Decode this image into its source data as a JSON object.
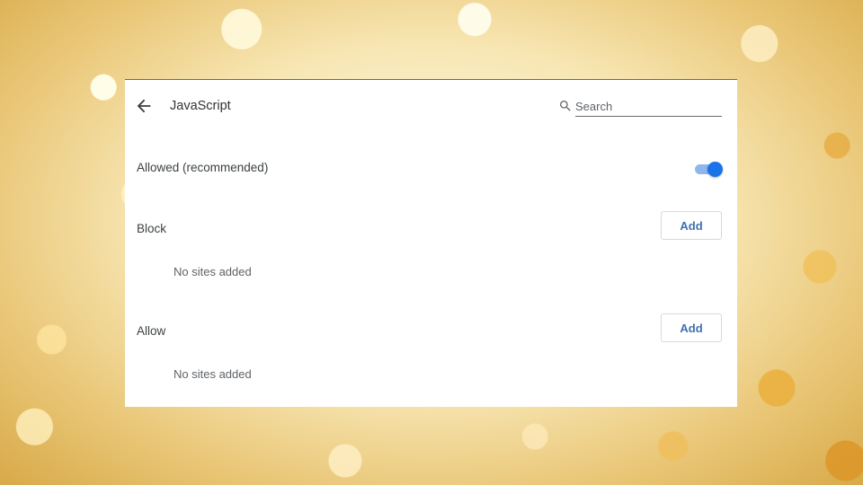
{
  "header": {
    "title": "JavaScript",
    "search_placeholder": "Search"
  },
  "default_setting": {
    "label": "Allowed (recommended)",
    "enabled": true
  },
  "sections": [
    {
      "label": "Block",
      "add_label": "Add",
      "empty_text": "No sites added"
    },
    {
      "label": "Allow",
      "add_label": "Add",
      "empty_text": "No sites added"
    }
  ],
  "colors": {
    "accent": "#1a73e8",
    "toggle_track": "#8fb6ee",
    "button_text": "#3f6fb0"
  }
}
